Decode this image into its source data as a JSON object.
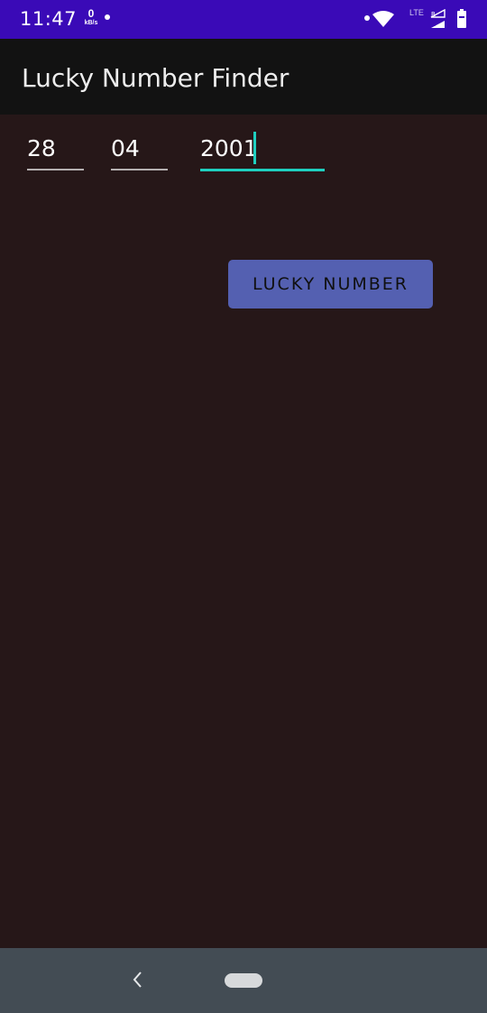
{
  "status_bar": {
    "time": "11:47",
    "net_speed_value": "0",
    "net_speed_unit": "kB/s",
    "network_type": "LTE",
    "color": "#3a0ab7"
  },
  "app_bar": {
    "title": "Lucky Number Finder"
  },
  "form": {
    "day_value": "28",
    "month_value": "04",
    "year_value": "2001"
  },
  "button": {
    "label": "LUCKY NUMBER",
    "color": "#5460b1"
  },
  "nav_bar": {
    "back_icon": "chevron-left-icon",
    "home_icon": "home-pill-icon"
  },
  "colors": {
    "background": "#261718",
    "accent": "#1fcfbf",
    "app_bar": "#121212",
    "nav_bar": "#434c54"
  }
}
